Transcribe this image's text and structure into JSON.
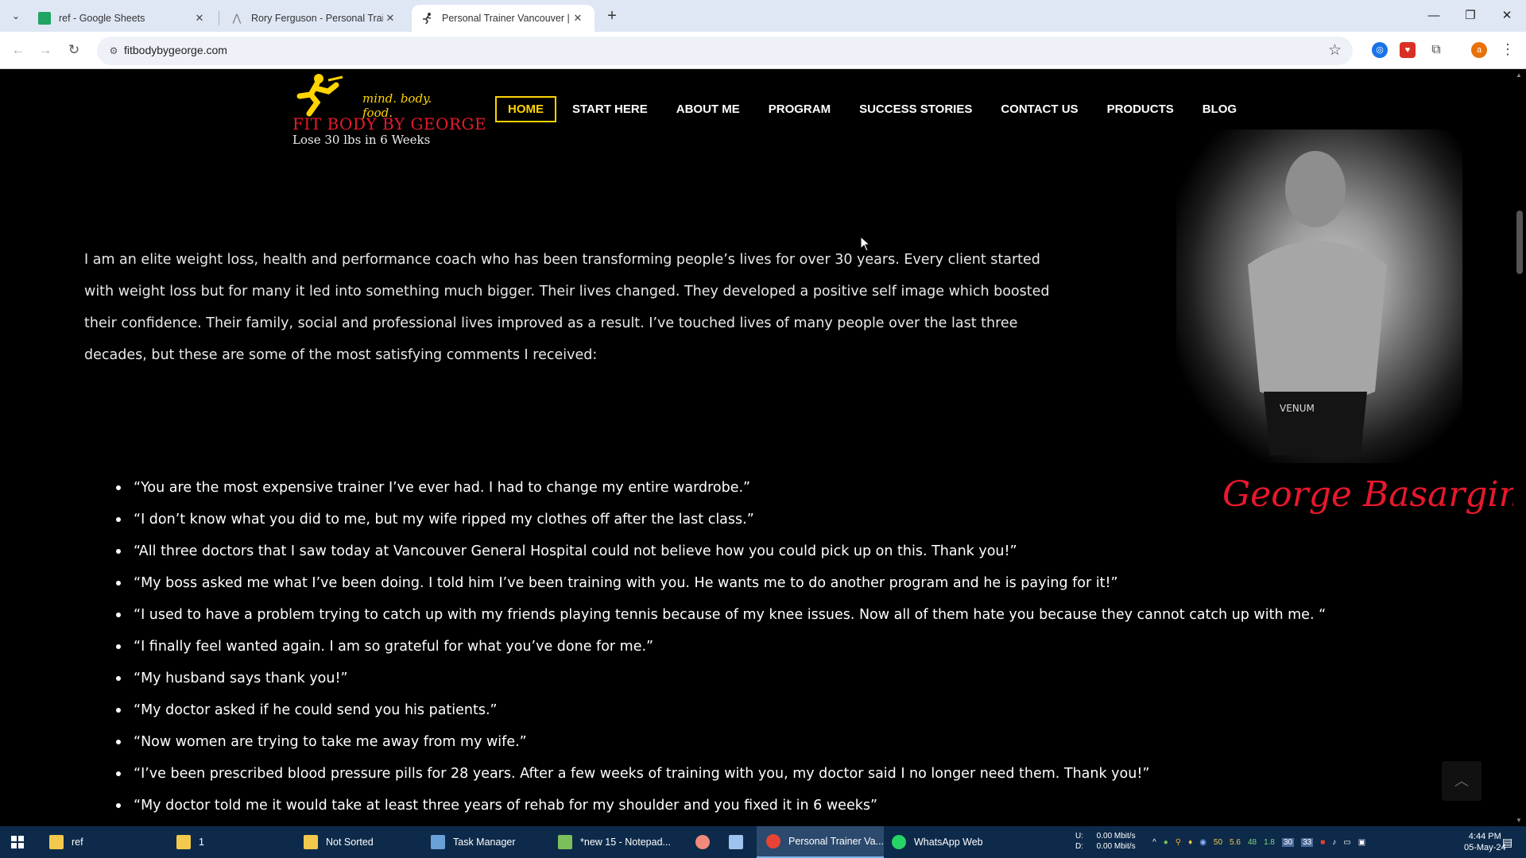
{
  "browser": {
    "tabs": [
      {
        "title": "ref - Google Sheets",
        "icon": "google-sheets-icon"
      },
      {
        "title": "Rory Ferguson - Personal Traini",
        "icon": "site-icon"
      },
      {
        "title": "Personal Trainer Vancouver | We",
        "icon": "runner-icon",
        "active": true
      }
    ],
    "url": "fitbodybygeorge.com"
  },
  "site": {
    "logo": {
      "tagline": "mind. body. food.",
      "brand": "FIT BODY BY GEORGE",
      "sub": "Lose 30 lbs in 6 Weeks"
    },
    "nav": [
      "HOME",
      "START HERE",
      "ABOUT ME",
      "PROGRAM",
      "SUCCESS STORIES",
      "CONTACT US",
      "PRODUCTS",
      "BLOG"
    ],
    "intro": "I am an elite weight loss, health and performance coach who has been transforming people’s lives for over 30 years. Every client started with weight loss but for many it led into something much bigger. Their lives changed. They developed a positive self image which boosted their confidence. Their family, social and professional lives improved as a result. I’ve touched lives of many people over the last three decades, but these are some of the most satisfying comments I received:",
    "quotes": [
      "“You are the most expensive trainer I’ve ever had. I had to change my entire wardrobe.”",
      "“I don’t know what you did to me, but my wife ripped my clothes off after the last class.”",
      "“All three doctors that I saw today at Vancouver General Hospital could not believe how you could pick up on this. Thank you!”",
      "“My boss asked me what I’ve been doing. I told him I’ve been training with you. He wants me to do another program and he is paying for it!”",
      "“I used to have a problem trying to catch up with my friends playing tennis because of my knee issues. Now all of them hate you because they cannot catch up with me. “",
      "“I finally feel wanted again. I am so grateful for what you’ve done for me.”",
      "“My husband says thank you!”",
      "“My doctor asked if he could send you his patients.”",
      "“Now women are trying to take me away from my wife.”",
      " “I’ve been prescribed blood pressure pills for 28 years. After a few weeks of training with you, my doctor said I no longer need them. Thank you!”",
      "“My doctor told me it would take at least three years of rehab for my shoulder and you fixed it in 6 weeks”"
    ],
    "photo_label": "VENUM",
    "signature": "George Basargin"
  },
  "taskbar": {
    "items": [
      {
        "label": "ref",
        "icon": "folder-icon",
        "color": "#f2c94c"
      },
      {
        "label": "1",
        "icon": "folder-icon",
        "color": "#f2c94c"
      },
      {
        "label": "Not Sorted",
        "icon": "folder-icon",
        "color": "#f2c94c"
      },
      {
        "label": "Task Manager",
        "icon": "task-manager-icon",
        "color": "#6aa0d8"
      },
      {
        "label": "*new 15 - Notepad...",
        "icon": "notepad-icon",
        "color": "#7cbf5a"
      },
      {
        "label": "",
        "icon": "app-icon",
        "color": "#f08a7a"
      },
      {
        "label": "",
        "icon": "document-icon",
        "color": "#9ec3ef"
      },
      {
        "label": "Personal Trainer Va...",
        "icon": "chrome-icon",
        "color": "#e94335",
        "active": true
      },
      {
        "label": "WhatsApp Web",
        "icon": "whatsapp-icon",
        "color": "#25d366"
      }
    ],
    "net": {
      "up": "U:",
      "down": "D:",
      "up_val": "0.00 Mbit/s",
      "down_val": "0.00 Mbit/s"
    },
    "tray_values": [
      "50",
      "5.6",
      "48",
      "1.8",
      "30",
      "33"
    ],
    "time": "4:44 PM",
    "date": "05-May-24"
  }
}
